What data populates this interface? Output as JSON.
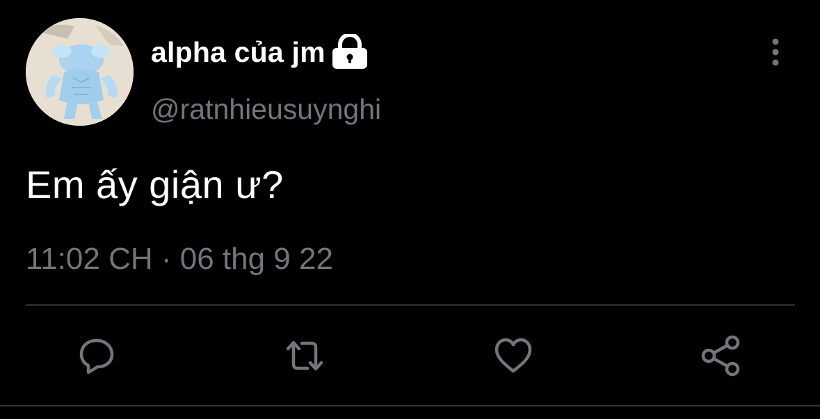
{
  "tweet": {
    "display_name": "alpha của jm",
    "handle": "@ratnhieusuynghi",
    "protected_icon": "lock-icon",
    "text": "Em ấy giận ư?",
    "timestamp": "11:02 CH · 06 thg 9 22",
    "avatar_icon": "avatar-cartoon-muscular-dog"
  },
  "header": {
    "more_icon": "more-vertical-icon"
  },
  "actions": [
    {
      "name": "reply",
      "icon": "speech-bubble-icon"
    },
    {
      "name": "retweet",
      "icon": "retweet-arrows-icon"
    },
    {
      "name": "like",
      "icon": "heart-icon"
    },
    {
      "name": "share",
      "icon": "share-icon"
    }
  ],
  "colors": {
    "background": "#000000",
    "primary_text": "#ffffff",
    "secondary_text": "#71767b",
    "divider": "#2f3336",
    "icon": "#71767b"
  }
}
